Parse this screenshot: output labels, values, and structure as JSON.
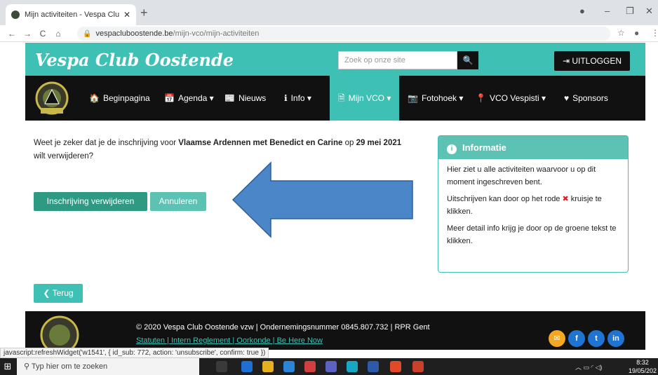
{
  "browser": {
    "tab_title": "Mijn activiteiten - Vespa Club Oo",
    "url_domain": "vespacluboostende.be",
    "url_path": "/mijn-vco/mijn-activiteiten",
    "status_text": "javascript:refreshWidget('w1541', { id_sub: 772, action: 'unsubscribe', confirm: true })"
  },
  "header": {
    "logo_text": "Vespa Club Oostende",
    "search_placeholder": "Zoek op onze site",
    "logout_label": "UITLOGGEN"
  },
  "nav": {
    "items": [
      {
        "label": "Beginpagina",
        "icon": "home-icon"
      },
      {
        "label": "Agenda ▾",
        "icon": "calendar-icon"
      },
      {
        "label": "Nieuws",
        "icon": "newspaper-icon"
      },
      {
        "label": "Info ▾",
        "icon": "info-icon"
      },
      {
        "label": "Mijn VCO ▾",
        "icon": "document-icon"
      },
      {
        "label": "Fotohoek ▾",
        "icon": "camera-icon"
      },
      {
        "label": "VCO Vespisti ▾",
        "icon": "pin-icon"
      },
      {
        "label": "Sponsors",
        "icon": "heart-icon"
      }
    ]
  },
  "confirm": {
    "part1": "Weet je zeker dat je de inschrijving voor ",
    "activity": "Vlaamse Ardennen met Benedict en Carine",
    "part2": " op ",
    "date": "29 mei 2021",
    "part3": " wilt verwijderen?",
    "delete_label": "Inschrijving verwijderen",
    "cancel_label": "Annuleren",
    "back_label": "Terug"
  },
  "info": {
    "title": "Informatie",
    "p1": "Hier ziet u alle activiteiten waarvoor u op dit moment ingeschreven bent.",
    "p2a": "Uitschrijven kan door op het rode ",
    "p2b": " kruisje te klikken.",
    "p3": "Meer detail info krijg je door op de groene tekst te klikken."
  },
  "footer": {
    "copyright": "© 2020 Vespa Club Oostende vzw | Ondernemingsnummer 0845.807.732 | RPR Gent",
    "links": "Statuten | Intern Reglement | Oorkonde | Be Here Now"
  },
  "taskbar": {
    "search_placeholder": "Typ hier om te zoeken",
    "time": "8:32",
    "date": "19/05/202"
  },
  "colors": {
    "brand": "#3ec1b4",
    "dark": "#111111",
    "danger_button": "#2f9a84",
    "arrow": "#4a86c8"
  }
}
